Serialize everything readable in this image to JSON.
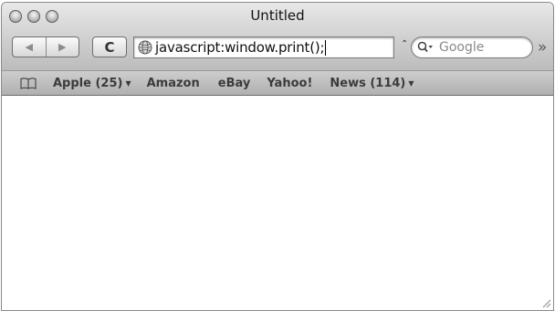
{
  "window": {
    "title": "Untitled"
  },
  "toolbar": {
    "back_label": "◀",
    "forward_label": "▶",
    "reload_label": "C",
    "address_value": "javascript:window.print();",
    "url_menu_arrow": "⌃",
    "search_placeholder": "Google",
    "overflow_label": "»"
  },
  "bookmarks": {
    "apple": {
      "label": "Apple (25)",
      "arrow": "▼"
    },
    "amazon": {
      "label": "Amazon"
    },
    "ebay": {
      "label": "eBay"
    },
    "yahoo": {
      "label": "Yahoo!"
    },
    "news": {
      "label": "News (114)",
      "arrow": "▼"
    }
  },
  "icons": [
    "close-icon",
    "minimize-icon",
    "zoom-icon",
    "back-icon",
    "forward-icon",
    "reload-icon",
    "globe-icon",
    "search-icon",
    "bookmarks-book-icon",
    "resize-grip-icon"
  ]
}
